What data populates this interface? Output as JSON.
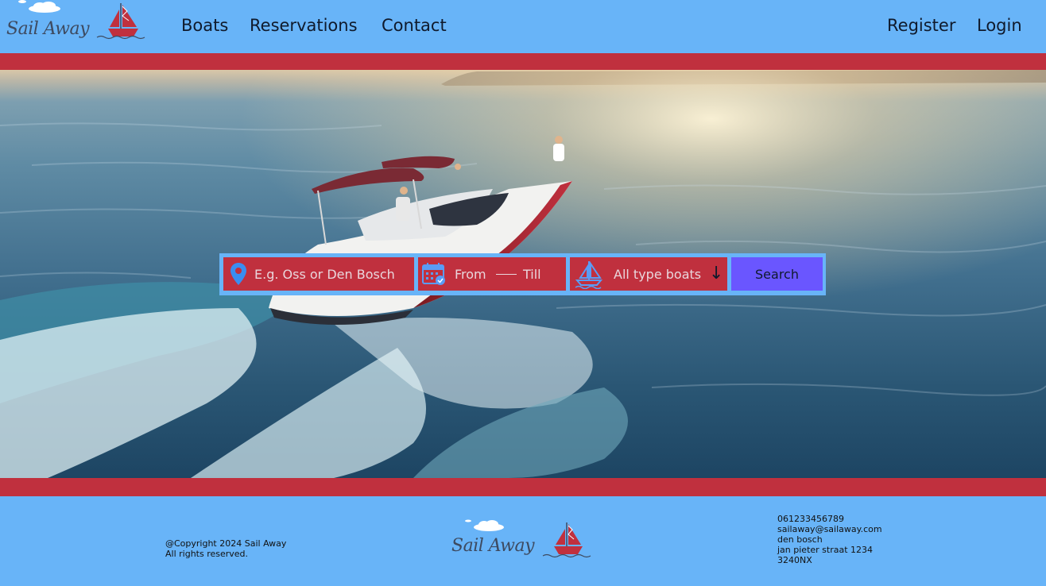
{
  "brand": {
    "name": "Sail Away"
  },
  "nav": {
    "boats": "Boats",
    "reservations": "Reservations",
    "contact": "Contact",
    "register": "Register",
    "login": "Login"
  },
  "search": {
    "location_placeholder": "E.g. Oss or Den Bosch",
    "from_label": "From",
    "till_label": "Till",
    "boat_type": "All type boats",
    "button_label": "Search"
  },
  "footer": {
    "copyright_line1": "@Copyright 2024 Sail Away",
    "copyright_line2": "All rights reserved.",
    "phone": "061233456789",
    "email": "sailaway@sailaway.com",
    "city": "den bosch",
    "street": "jan pieter straat 1234",
    "postcode": "3240NX"
  },
  "colors": {
    "header_bg": "#68b4f8",
    "accent_red": "#c0303e",
    "search_button": "#6a56ff"
  },
  "icons": [
    "location-pin-icon",
    "calendar-icon",
    "boat-icon",
    "arrow-down-icon",
    "sailboat-logo-icon",
    "cloud-icon"
  ]
}
